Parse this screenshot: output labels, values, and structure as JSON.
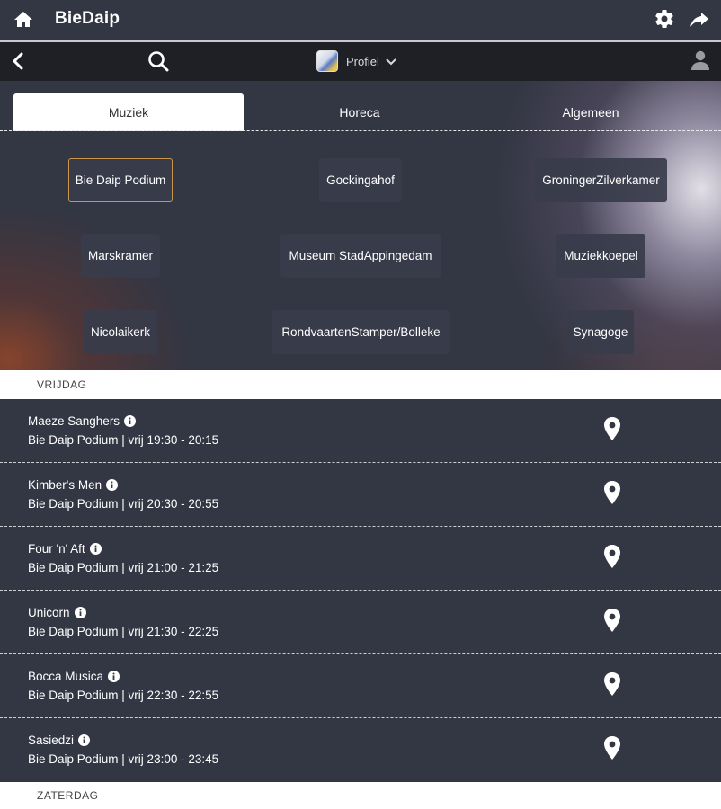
{
  "app": {
    "title": "BieDaip"
  },
  "toolbar": {
    "profile_label": "Profiel"
  },
  "tabs": [
    {
      "label": "Muziek",
      "active": true
    },
    {
      "label": "Horeca",
      "active": false
    },
    {
      "label": "Algemeen",
      "active": false
    }
  ],
  "venues": [
    {
      "label": "Bie Daip Podium",
      "selected": true
    },
    {
      "label": "Gockingahof"
    },
    {
      "label": "GroningerZilverkamer"
    },
    {
      "label": "Marskramer"
    },
    {
      "label": "Museum StadAppingedam"
    },
    {
      "label": "Muziekkoepel"
    },
    {
      "label": "Nicolaikerk"
    },
    {
      "label": "RondvaartenStamper/Bolleke"
    },
    {
      "label": "Synagoge"
    }
  ],
  "days": [
    {
      "label": "VRIJDAG"
    },
    {
      "label": "ZATERDAG"
    }
  ],
  "events": [
    {
      "name": "Maeze Sanghers",
      "meta": "Bie Daip Podium | vrij 19:30 - 20:15"
    },
    {
      "name": "Kimber's Men",
      "meta": "Bie Daip Podium | vrij 20:30 - 20:55"
    },
    {
      "name": "Four 'n' Aft",
      "meta": "Bie Daip Podium | vrij 21:00 - 21:25"
    },
    {
      "name": "Unicorn",
      "meta": "Bie Daip Podium | vrij 21:30 - 22:25"
    },
    {
      "name": "Bocca Musica",
      "meta": "Bie Daip Podium | vrij 22:30 - 22:55"
    },
    {
      "name": "Sasiedzi",
      "meta": "Bie Daip Podium | vrij 23:00 - 23:45"
    }
  ],
  "colors": {
    "appbar": "#333744",
    "toolbar": "#1f2026",
    "list_bg": "#333643",
    "selected_border": "#c9964a"
  }
}
